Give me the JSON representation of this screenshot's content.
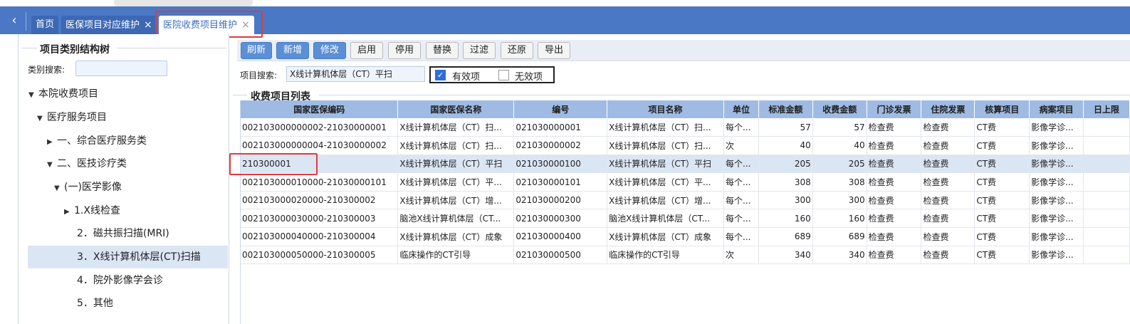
{
  "tabs": {
    "back_icon": "chevron-left-icon",
    "items": [
      {
        "label": "首页",
        "closable": false
      },
      {
        "label": "医保项目对应维护",
        "closable": true
      },
      {
        "label": "医院收费项目维护",
        "closable": true,
        "active": true
      }
    ],
    "close_glyph": "×"
  },
  "tree": {
    "title": "项目类别结构树",
    "search_label": "类别搜索:",
    "search_value": "",
    "nodes": [
      {
        "label": "本院收费项目",
        "expanded": true
      },
      {
        "label": "医疗服务项目",
        "expanded": true
      },
      {
        "label": "一、综合医疗服务类",
        "expanded": false
      },
      {
        "label": "二、医技诊疗类",
        "expanded": true
      },
      {
        "label": "(一)医学影像",
        "expanded": true
      },
      {
        "label": "1.X线检查",
        "expanded": false
      },
      {
        "label": "2．磁共振扫描(MRI)"
      },
      {
        "label": "3．X线计算机体层(CT)扫描",
        "selected": true
      },
      {
        "label": "4．院外影像学会诊"
      },
      {
        "label": "5．其他"
      }
    ]
  },
  "toolbar": {
    "buttons": [
      {
        "label": "刷新",
        "style": "primary"
      },
      {
        "label": "新增",
        "style": "primary"
      },
      {
        "label": "修改",
        "style": "primary"
      },
      {
        "label": "启用",
        "style": "plain"
      },
      {
        "label": "停用",
        "style": "plain"
      },
      {
        "label": "替换",
        "style": "plain"
      },
      {
        "label": "过滤",
        "style": "plain"
      },
      {
        "label": "还原",
        "style": "plain"
      },
      {
        "label": "导出",
        "style": "plain"
      }
    ]
  },
  "search": {
    "label": "项目搜索:",
    "value": "X线计算机体层（CT）平扫",
    "valid_label": "有效项",
    "valid_checked": true,
    "invalid_label": "无效项",
    "invalid_checked": false
  },
  "list": {
    "title": "收费项目列表",
    "columns": [
      "国家医保编码",
      "国家医保名称",
      "编号",
      "项目名称",
      "单位",
      "标准金额",
      "收费金额",
      "门诊发票",
      "住院发票",
      "核算项目",
      "病案项目",
      "日上限"
    ],
    "rows": [
      [
        "002103000000002-21030000001",
        "X线计算机体层（CT）扫...",
        "021030000001",
        "X线计算机体层（CT）扫...",
        "每个...",
        "57",
        "57",
        "检查费",
        "检查费",
        "CT费",
        "影像学诊...",
        ""
      ],
      [
        "002103000000004-21030000002",
        "X线计算机体层（CT）扫...",
        "021030000002",
        "X线计算机体层（CT）扫...",
        "次",
        "40",
        "40",
        "检查费",
        "检查费",
        "CT费",
        "影像学诊...",
        ""
      ],
      [
        "210300001",
        "X线计算机体层（CT）平扫",
        "021030000100",
        "X线计算机体层（CT）平扫",
        "每个...",
        "205",
        "205",
        "检查费",
        "检查费",
        "CT费",
        "影像学诊...",
        ""
      ],
      [
        "002103000010000-21030000101",
        "X线计算机体层（CT）平...",
        "021030000101",
        "X线计算机体层（CT）平...",
        "每个...",
        "308",
        "308",
        "检查费",
        "检查费",
        "CT费",
        "影像学诊...",
        ""
      ],
      [
        "002103000020000-210300002",
        "X线计算机体层（CT）增...",
        "021030000200",
        "X线计算机体层（CT）增...",
        "每个...",
        "300",
        "300",
        "检查费",
        "检查费",
        "CT费",
        "影像学诊...",
        ""
      ],
      [
        "002103000030000-210300003",
        "脑池X线计算机体层（CT...",
        "021030000300",
        "脑池X线计算机体层（CT...",
        "每个...",
        "160",
        "160",
        "检查费",
        "检查费",
        "CT费",
        "影像学诊...",
        ""
      ],
      [
        "002103000040000-210300004",
        "X线计算机体层（CT）成象",
        "021030000400",
        "X线计算机体层（CT）成象",
        "每个...",
        "689",
        "689",
        "检查费",
        "检查费",
        "CT费",
        "影像学诊...",
        ""
      ],
      [
        "002103000050000-210300005",
        "临床操作的CT引导",
        "021030000500",
        "临床操作的CT引导",
        "次",
        "340",
        "340",
        "检查费",
        "检查费",
        "CT费",
        "影像学诊...",
        ""
      ]
    ],
    "selected_row": 2
  },
  "colors": {
    "accent": "#4a78c4",
    "highlight": "#e23a3a",
    "header": "#9fbbe3",
    "selection": "#dbe6f5"
  }
}
